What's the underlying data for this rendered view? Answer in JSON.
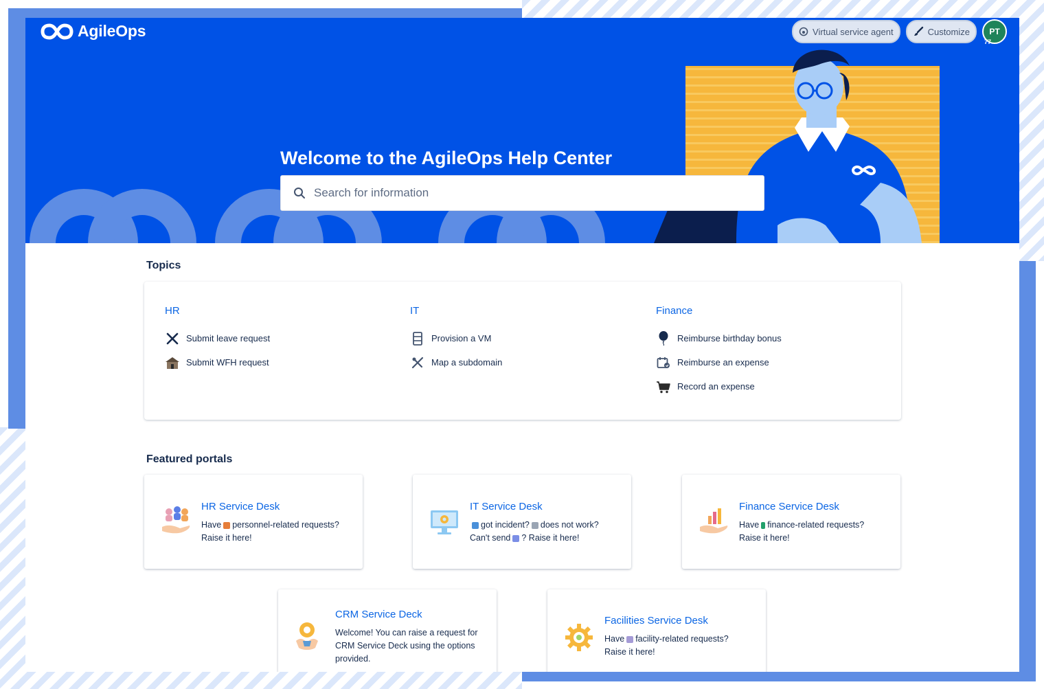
{
  "app": {
    "brand": "AgileOps",
    "actions": {
      "virtual_agent": "Virtual service agent",
      "customize": "Customize"
    },
    "user": {
      "initials": "PT",
      "badge": "77"
    }
  },
  "hero": {
    "title": "Welcome to the AgileOps Help Center",
    "search_placeholder": "Search for information"
  },
  "topics": {
    "heading": "Topics",
    "groups": [
      {
        "title": "HR",
        "items": [
          {
            "label": "Submit leave request",
            "icon": "airplane-icon"
          },
          {
            "label": "Submit WFH request",
            "icon": "house-icon"
          }
        ]
      },
      {
        "title": "IT",
        "items": [
          {
            "label": "Provision a VM",
            "icon": "server-icon"
          },
          {
            "label": "Map a subdomain",
            "icon": "tools-icon"
          }
        ]
      },
      {
        "title": "Finance",
        "items": [
          {
            "label": "Reimburse birthday bonus",
            "icon": "balloon-icon"
          },
          {
            "label": "Reimburse an expense",
            "icon": "calendar-icon"
          },
          {
            "label": "Record an expense",
            "icon": "cart-icon"
          }
        ]
      }
    ]
  },
  "featured": {
    "heading": "Featured portals",
    "portals": [
      {
        "title": "HR Service Desk",
        "line1a": "Have",
        "line1b": "personnel-related requests?",
        "line2": "Raise it here!"
      },
      {
        "title": "IT Service Desk",
        "line1a": "got incident?",
        "line1b": "does not work?",
        "line2a": "Can't send",
        "line2b": "? Raise it here!"
      },
      {
        "title": "Finance Service Desk",
        "line1a": "Have",
        "line1b": "finance-related requests?",
        "line2": "Raise it here!"
      },
      {
        "title": "CRM Service Deck",
        "desc": "Welcome! You can raise a request for CRM Service Deck using the options provided."
      },
      {
        "title": "Facilities Service Desk",
        "line1a": "Have",
        "line1b": "facility-related requests?",
        "line2": "Raise it here!"
      }
    ]
  },
  "colors": {
    "hero_blue": "#0052e6",
    "link_blue": "#0c66e4",
    "avatar_green": "#1f845a",
    "accent_yellow": "#f6b73c"
  }
}
